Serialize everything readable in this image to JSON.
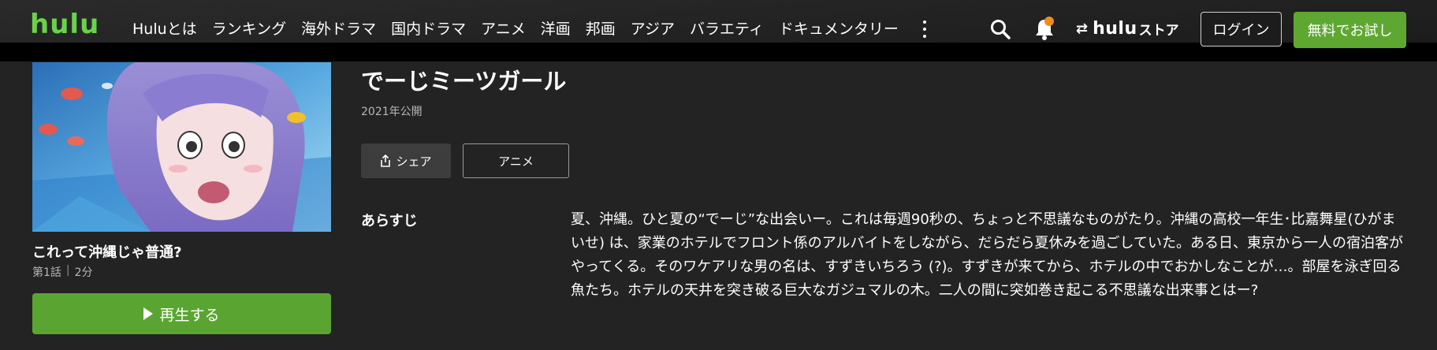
{
  "header": {
    "logo": "hulu",
    "nav": [
      "Huluとは",
      "ランキング",
      "海外ドラマ",
      "国内ドラマ",
      "アニメ",
      "洋画",
      "邦画",
      "アジア",
      "バラエティ",
      "ドキュメンタリー"
    ],
    "store_brand": "hulu",
    "store_suffix": "ストア",
    "login_label": "ログイン",
    "trial_label": "無料でお試し",
    "icons": {
      "more": "kebab-icon",
      "search": "search-icon",
      "notifications": "bell-icon",
      "store": "swap-arrows-icon"
    },
    "notification_dot_color": "#f08c1e",
    "accent_color": "#5aa531"
  },
  "episode": {
    "title": "これって沖縄じゃ普通?",
    "number": "第1話",
    "duration": "2分",
    "play_label": "再生する"
  },
  "series": {
    "title": "でーじミーツガール",
    "year": "2021年公開",
    "share_label": "シェア",
    "genre_label": "アニメ",
    "synopsis_label": "あらすじ",
    "synopsis": "夏、沖縄。ひと夏の“でーじ”な出会いー。これは毎週90秒の、ちょっと不思議なものがたり。沖縄の高校一年生･比嘉舞星(ひがまいせ) は、家業のホテルでフロント係のアルバイトをしながら、だらだら夏休みを過ごしていた。ある日、東京から一人の宿泊客がやってくる。そのワケアリな男の名は、すずきいちろう (?)。すずきが来てから、ホテルの中でおかしなことが…。部屋を泳ぎ回る魚たち。ホテルの天井を突き破る巨大なガジュマルの木。二人の間に突如巻き起こる不思議な出来事とはー?"
  }
}
